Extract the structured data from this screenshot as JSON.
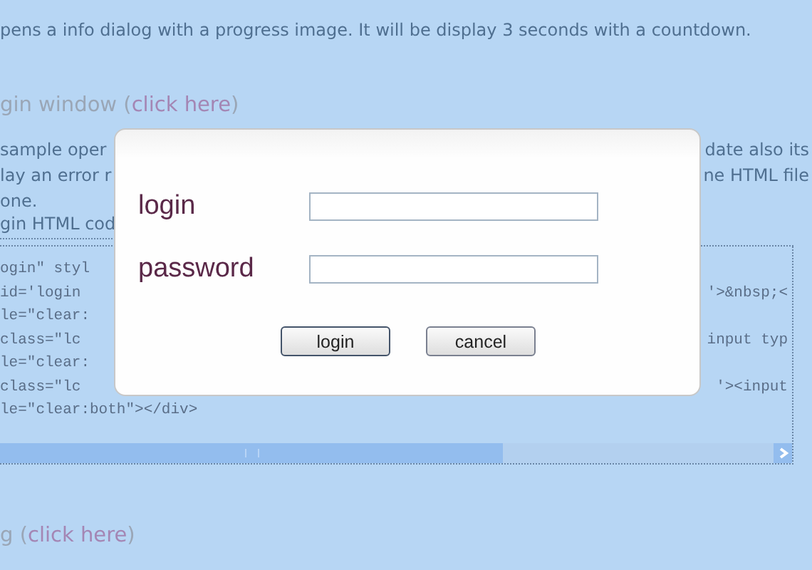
{
  "intro": "pens a info dialog with a progress image. It will be display 3 seconds with a countdown.",
  "section": {
    "title": "gin window (",
    "link": "click here",
    "suffix": ")"
  },
  "description_lines": [
    {
      "left": "sample oper",
      "right": "date also its"
    },
    {
      "left": "lay an error r",
      "right": "ne HTML file"
    },
    {
      "left": "one."
    }
  ],
  "code_caption": "gin HTML cod",
  "code_lines": [
    {
      "left": "ogin\" styl"
    },
    {
      "left": "id='login",
      "right": "'>&nbsp;<"
    },
    {
      "left": "le=\"clear:"
    },
    {
      "left": "class=\"lc",
      "right": "input typ"
    },
    {
      "left": "le=\"clear:"
    },
    {
      "left": "class=\"lc",
      "right": "'><input"
    },
    {
      "left": "le=\"clear:both\"></div>"
    }
  ],
  "footer_section": {
    "title": "g (",
    "link": "click here",
    "suffix": ")"
  },
  "dialog": {
    "fields": [
      {
        "label": "login"
      },
      {
        "label": "password"
      }
    ],
    "buttons": [
      "login",
      "cancel"
    ]
  }
}
